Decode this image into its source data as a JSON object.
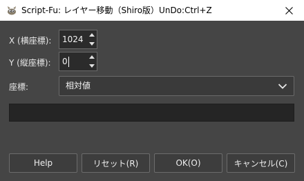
{
  "window": {
    "title": "Script-Fu: レイヤー移動（Shiro版）UnDo:Ctrl+Z"
  },
  "icons": {
    "app": "gimp-wilber-icon",
    "close": "close-icon",
    "spin_up": "chevron-up-icon",
    "spin_down": "chevron-down-icon",
    "combo": "chevron-down-icon"
  },
  "form": {
    "x_label": "X (横座標):",
    "x_value": "1024",
    "y_label": "Y (縦座標):",
    "y_value": "0",
    "coord_label": "座標:",
    "coord_value": "相対値"
  },
  "buttons": {
    "help": "Help",
    "reset": "リセット(R)",
    "ok": "OK(O)",
    "cancel": "キャンセル(C)"
  },
  "colors": {
    "dialog_bg": "#454545",
    "titlebar_bg": "#ffffff",
    "input_bg": "#2b2b2b",
    "progress_bg": "#252525"
  }
}
